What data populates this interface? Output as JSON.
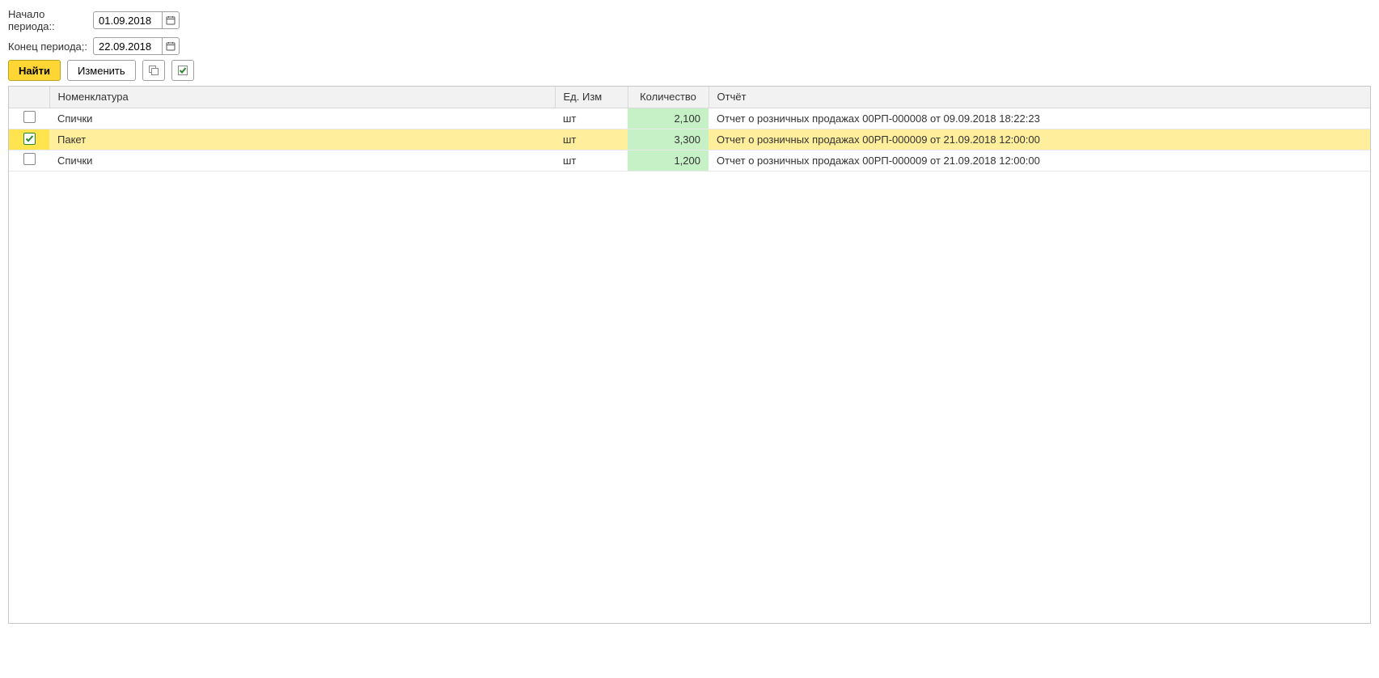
{
  "filters": {
    "start_label": "Начало периода::",
    "start_value": "01.09.2018",
    "end_label": "Конец периода;:",
    "end_value": "22.09.2018"
  },
  "toolbar": {
    "find_label": "Найти",
    "change_label": "Изменить"
  },
  "table": {
    "headers": {
      "check": "",
      "nomen": "Номенклатура",
      "unit": "Ед. Изм",
      "qty": "Количество",
      "report": "Отчёт"
    },
    "rows": [
      {
        "checked": false,
        "selected": false,
        "nomen": "Спички",
        "unit": "шт",
        "qty": "2,100",
        "report": "Отчет о розничных продажах 00РП-000008 от 09.09.2018 18:22:23"
      },
      {
        "checked": true,
        "selected": true,
        "nomen": "Пакет",
        "unit": "шт",
        "qty": "3,300",
        "report": "Отчет о розничных продажах 00РП-000009 от 21.09.2018 12:00:00"
      },
      {
        "checked": false,
        "selected": false,
        "nomen": "Спички",
        "unit": "шт",
        "qty": "1,200",
        "report": "Отчет о розничных продажах 00РП-000009 от 21.09.2018 12:00:00"
      }
    ]
  }
}
